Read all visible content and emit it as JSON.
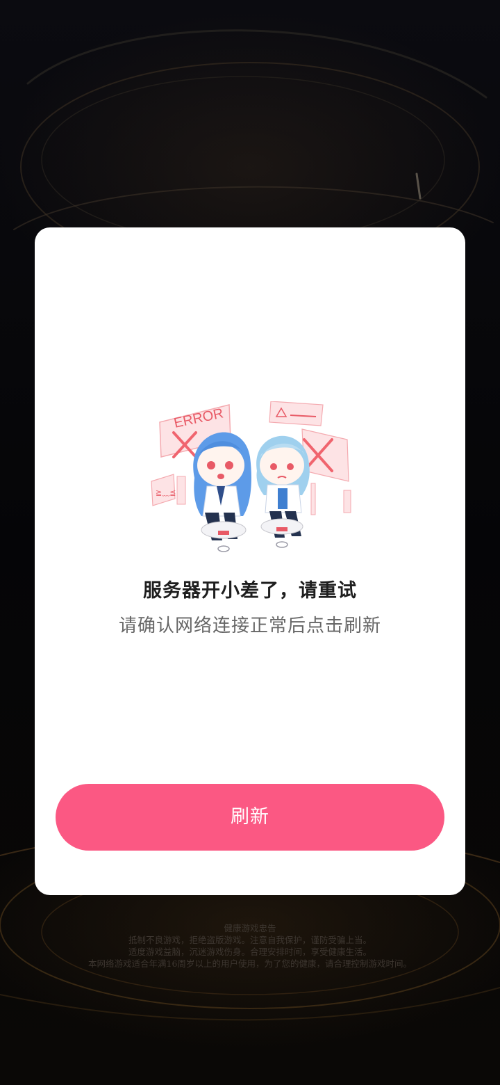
{
  "dialog": {
    "illustration": {
      "error_word": "ERROR",
      "accent_color": "#f0646e"
    },
    "title": "服务器开小差了，请重试",
    "subtitle": "请确认网络连接正常后点击刷新",
    "refresh_label": "刷新",
    "button_color": "#fb5883"
  },
  "health_notice": {
    "heading": "健康游戏忠告",
    "line1": "抵制不良游戏，拒绝盗版游戏。注意自我保护，谨防受骗上当。",
    "line2": "适度游戏益脑，沉迷游戏伤身。合理安排时间，享受健康生活。",
    "line3": "本网络游戏适合年满16周岁以上的用户使用，为了您的健康，请合理控制游戏时间。"
  }
}
